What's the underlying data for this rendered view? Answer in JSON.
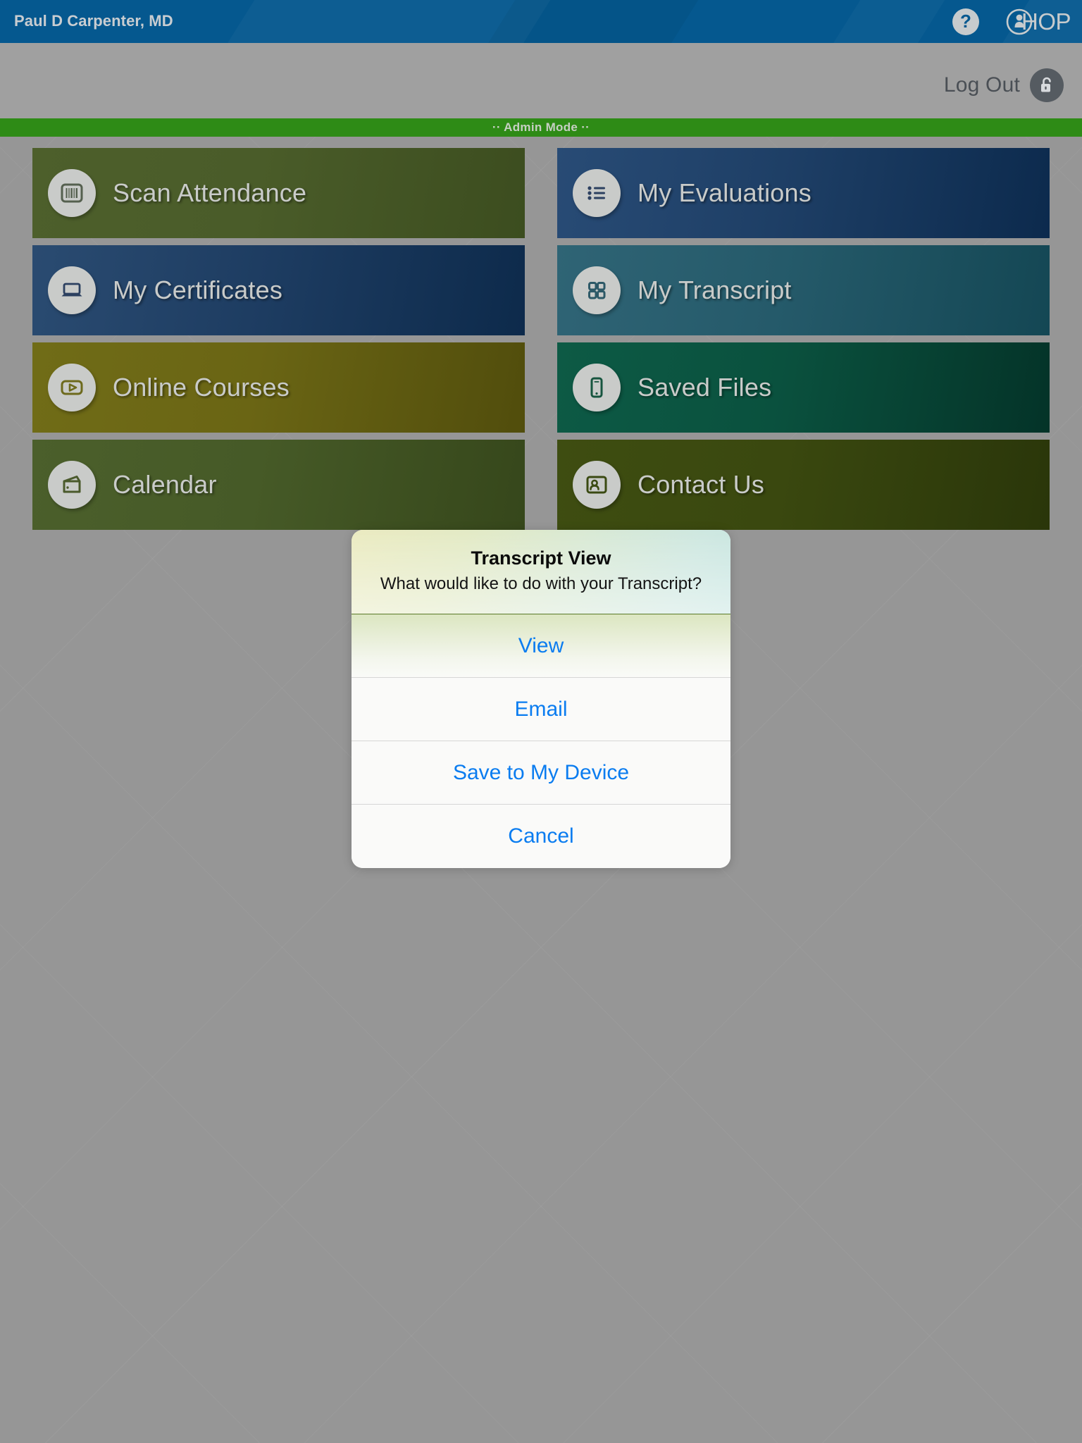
{
  "header": {
    "user_name": "Paul D Carpenter, MD",
    "help_icon": "help-question-icon",
    "help_glyph": "?",
    "brand_wordmark": "HOP",
    "brand_icon": "chop-child-mark-icon",
    "brand_color": "#05588f"
  },
  "subheader": {
    "logout_label": "Log Out",
    "logout_icon": "unlocked-padlock-icon"
  },
  "admin_bar": {
    "label": "·· Admin Mode ··",
    "color": "#2e8b16"
  },
  "tiles": [
    {
      "label": "Scan Attendance",
      "icon": "barcode-icon",
      "theme": "t-olivegreen"
    },
    {
      "label": "My Evaluations",
      "icon": "bulleted-list-icon",
      "theme": "t-navy"
    },
    {
      "label": "My Certificates",
      "icon": "laptop-icon",
      "theme": "t-darkblue"
    },
    {
      "label": "My Transcript",
      "icon": "grid-squares-icon",
      "theme": "t-teal"
    },
    {
      "label": "Online Courses",
      "icon": "video-play-icon",
      "theme": "t-gold"
    },
    {
      "label": "Saved Files",
      "icon": "mobile-phone-icon",
      "theme": "t-forest"
    },
    {
      "label": "Calendar",
      "icon": "wallet-folder-icon",
      "theme": "t-moss"
    },
    {
      "label": "Contact Us",
      "icon": "contact-icon",
      "theme": "t-darkolive"
    }
  ],
  "dialog": {
    "title": "Transcript View",
    "message": "What would like to do with your Transcript?",
    "buttons": [
      {
        "label": "View"
      },
      {
        "label": "Email"
      },
      {
        "label": "Save to My Device"
      },
      {
        "label": "Cancel"
      }
    ],
    "accent_color": "#0a7cf0"
  }
}
